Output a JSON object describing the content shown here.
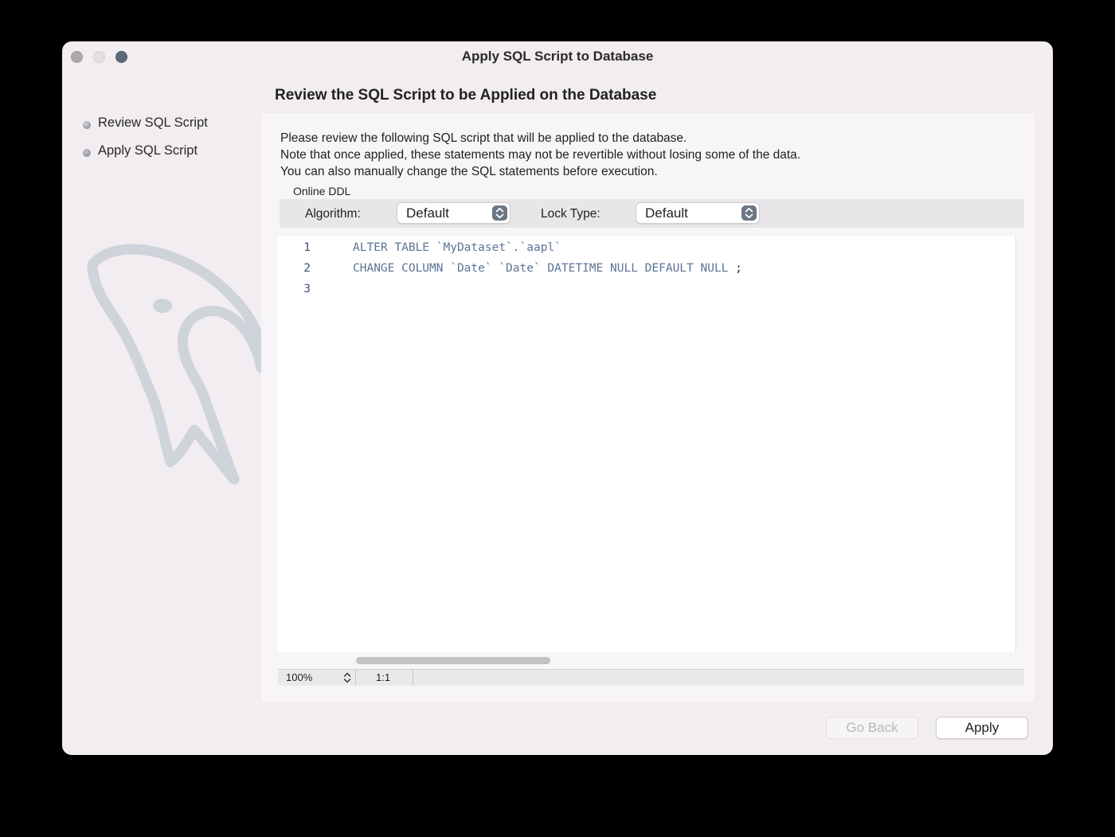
{
  "window": {
    "title": "Apply SQL Script to Database"
  },
  "heading": "Review the SQL Script to be Applied on the Database",
  "steps": [
    {
      "label": "Review SQL Script",
      "active": true
    },
    {
      "label": "Apply SQL Script",
      "active": false
    }
  ],
  "description": [
    "Please review the following SQL script that will be applied to the database.",
    "Note that once applied, these statements may not be revertible without losing some of the data.",
    "You can also manually change the SQL statements before execution."
  ],
  "online_ddl": {
    "title": "Online DDL",
    "algorithm_label": "Algorithm:",
    "algorithm_value": "Default",
    "lock_type_label": "Lock Type:",
    "lock_type_value": "Default"
  },
  "editor": {
    "lines": [
      {
        "number": "1",
        "code": "ALTER TABLE `MyDataset`.`aapl`",
        "punct": ""
      },
      {
        "number": "2",
        "code": "CHANGE COLUMN `Date` `Date` DATETIME NULL DEFAULT NULL ",
        "punct": ";"
      },
      {
        "number": "3",
        "code": "",
        "punct": ""
      }
    ],
    "zoom": "100%",
    "cursor_position": "1:1"
  },
  "buttons": {
    "go_back": "Go Back",
    "apply": "Apply"
  },
  "colors": {
    "window_bg": "#f1edf1",
    "sql_keyword": "#5d7397",
    "zoom_traffic_light": "#5c6978"
  }
}
